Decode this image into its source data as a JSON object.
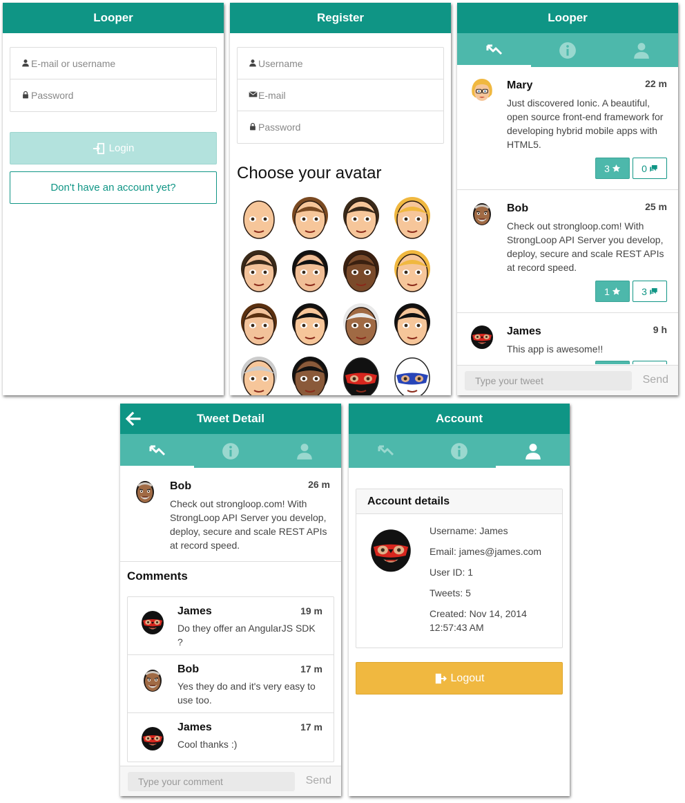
{
  "login": {
    "title": "Looper",
    "username_placeholder": "E-mail or username",
    "password_placeholder": "Password",
    "login_label": "Login",
    "register_link": "Don't have an account yet?"
  },
  "register": {
    "title": "Register",
    "username_placeholder": "Username",
    "email_placeholder": "E-mail",
    "password_placeholder": "Password",
    "choose_avatar": "Choose your avatar",
    "avatars": [
      "bald-man",
      "brown-hair-man",
      "bearded-man",
      "blond-man",
      "brunette-woman",
      "black-hair-woman",
      "dreadlock-woman",
      "blonde-woman",
      "brunette-girl",
      "glasses-woman",
      "gray-hair-man",
      "mustache-man",
      "gray-bald-man",
      "mohawk-man",
      "red-luchador",
      "blue-luchador"
    ]
  },
  "feed": {
    "title": "Looper",
    "tabs": [
      "tweets-icon",
      "info-icon",
      "user-icon"
    ],
    "posts": [
      {
        "name": "Mary",
        "time": "22 m",
        "text": "Just discovered Ionic. A beautiful, open source front-end framework for developing hybrid mobile apps with HTML5.",
        "stars": "3",
        "comments": "0"
      },
      {
        "name": "Bob",
        "time": "25 m",
        "text": "Check out strongloop.com! With StrongLoop API Server you develop, deploy, secure and scale REST APIs at record speed.",
        "stars": "1",
        "comments": "3"
      },
      {
        "name": "James",
        "time": "9 h",
        "text": "This app is awesome!!",
        "stars": "",
        "comments": ""
      }
    ],
    "tweet_placeholder": "Type your tweet",
    "send_label": "Send"
  },
  "detail": {
    "title": "Tweet Detail",
    "post": {
      "name": "Bob",
      "time": "26 m",
      "text": "Check out strongloop.com! With StrongLoop API Server you develop, deploy, secure and scale REST APIs at record speed."
    },
    "comments_heading": "Comments",
    "comments": [
      {
        "name": "James",
        "time": "19 m",
        "text": "Do they offer an AngularJS SDK ?"
      },
      {
        "name": "Bob",
        "time": "17 m",
        "text": "Yes they do and it's very easy to use too."
      },
      {
        "name": "James",
        "time": "17 m",
        "text": "Cool thanks :)"
      }
    ],
    "comment_placeholder": "Type your comment",
    "send_label": "Send"
  },
  "account": {
    "title": "Account",
    "card_title": "Account details",
    "username": "Username: James",
    "email": "Email: james@james.com",
    "user_id": "User ID: 1",
    "tweets": "Tweets: 5",
    "created": "Created: Nov 14, 2014 12:57:43 AM",
    "logout_label": "Logout"
  },
  "colors": {
    "primary": "#0f9585",
    "tabbar": "#4db8ab",
    "light": "#b3e2dd",
    "logout": "#f0b840"
  }
}
